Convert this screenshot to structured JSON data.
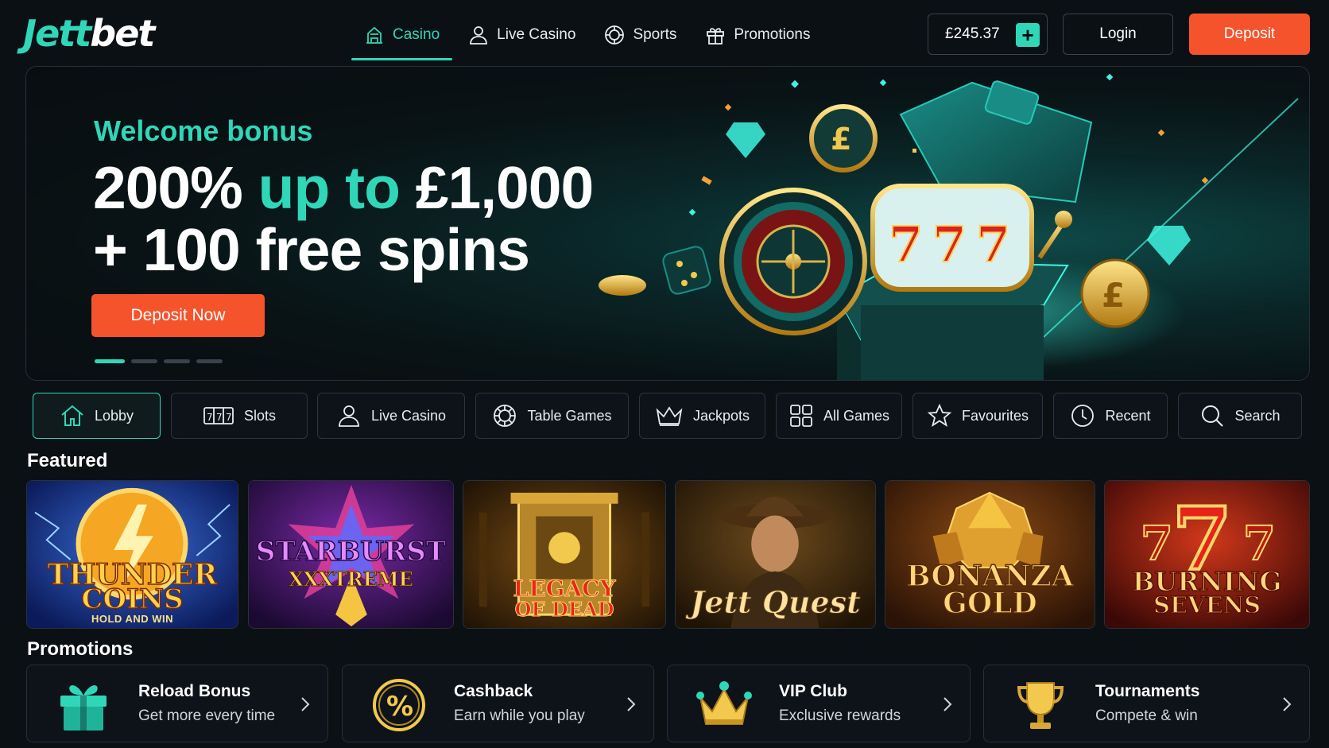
{
  "brand": {
    "logo_part1": "Jett",
    "logo_part2": "bet"
  },
  "nav": {
    "items": [
      {
        "label": "Casino",
        "icon": "casino-icon",
        "active": true
      },
      {
        "label": "Live Casino",
        "icon": "user-icon"
      },
      {
        "label": "Sports",
        "icon": "ball-icon"
      },
      {
        "label": "Promotions",
        "icon": "gift-icon"
      }
    ]
  },
  "account": {
    "balance": "£245.37",
    "add_funds_icon": "plus-icon",
    "login_label": "Login",
    "deposit_label": "Deposit"
  },
  "hero": {
    "eyebrow": "Welcome bonus",
    "line1_a": "200% ",
    "line1_b": "up to",
    "line1_c": " £1,000",
    "line2": "+ 100 free spins",
    "cta_label": "Deposit Now",
    "slides": {
      "count": 4,
      "active": 1
    }
  },
  "categories": [
    {
      "label": "Lobby",
      "icon": "home-icon",
      "active": true
    },
    {
      "label": "Slots",
      "icon": "slots-icon"
    },
    {
      "label": "Live Casino",
      "icon": "user-icon"
    },
    {
      "label": "Table Games",
      "icon": "chip-icon"
    },
    {
      "label": "Jackpots",
      "icon": "crown-icon"
    },
    {
      "label": "All Games",
      "icon": "grid-icon"
    },
    {
      "label": "Favourites",
      "icon": "star-icon"
    },
    {
      "label": "Recent",
      "icon": "clock-icon"
    },
    {
      "label": "Search",
      "icon": "search-icon"
    }
  ],
  "featured": {
    "title": "Featured",
    "games": [
      {
        "line1": "THUNDER",
        "line2": "COINS",
        "sub": "HOLD AND WIN"
      },
      {
        "line1": "STARBURST",
        "line2": "XXXTREME",
        "sub": ""
      },
      {
        "line1": "LEGACY",
        "line2": "OF DEAD",
        "sub": ""
      },
      {
        "line1": "Jett Quest",
        "line2": "",
        "sub": ""
      },
      {
        "line1": "BONANZA",
        "line2": "GOLD",
        "sub": ""
      },
      {
        "line1": "BURNING",
        "line2": "SEVENS",
        "sub": ""
      }
    ]
  },
  "promotions": {
    "title": "Promotions",
    "items": [
      {
        "title": "Reload Bonus",
        "subtitle": "Get more every time",
        "icon": "gift-icon"
      },
      {
        "title": "Cashback",
        "subtitle": "Earn while you play",
        "icon": "percent-icon"
      },
      {
        "title": "VIP Club",
        "subtitle": "Exclusive rewards",
        "icon": "crown-icon"
      },
      {
        "title": "Tournaments",
        "subtitle": "Compete & win",
        "icon": "trophy-icon"
      }
    ]
  },
  "colors": {
    "accent": "#2fd6b8",
    "cta": "#f4532c",
    "background": "#0b1015"
  }
}
